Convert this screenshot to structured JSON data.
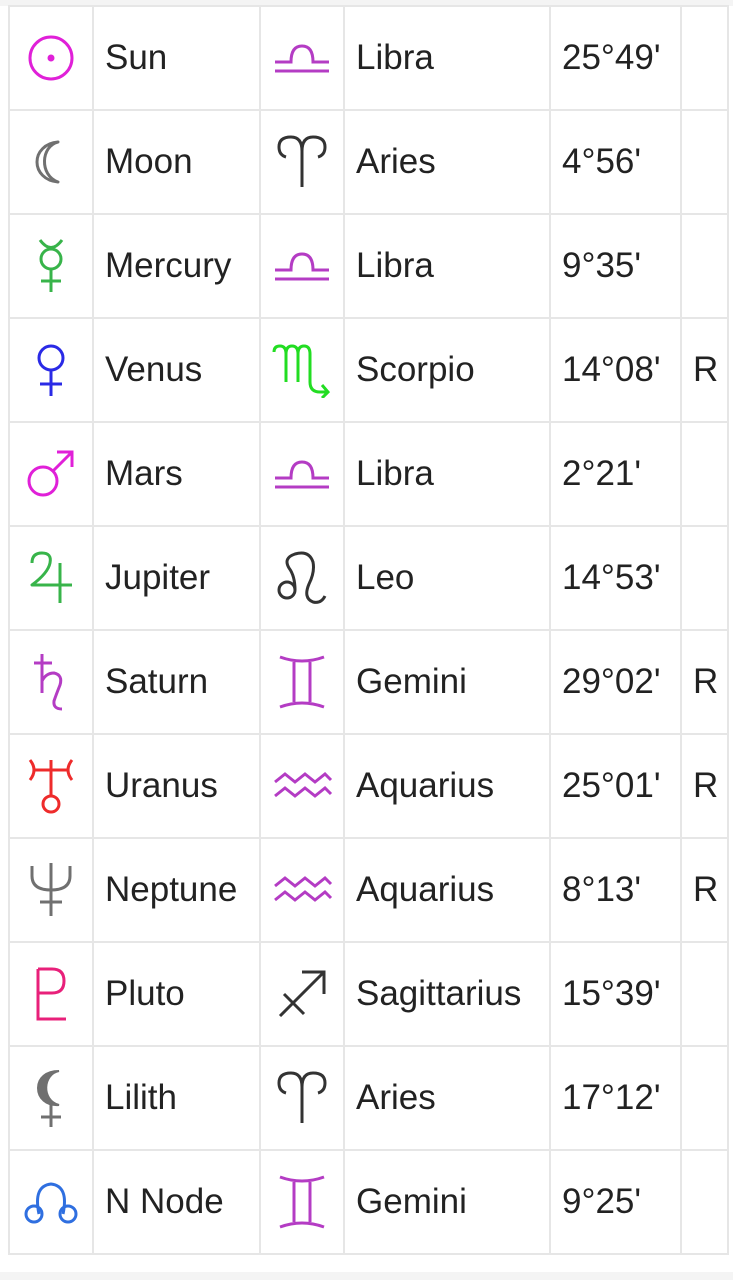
{
  "colors": {
    "magenta": "#e020d8",
    "purple": "#b43cc4",
    "gray": "#707070",
    "green": "#38b44a",
    "blue": "#2a2ae6",
    "bright_green": "#22dd22",
    "red": "#ee2b2b",
    "pink": "#e8207a",
    "dark": "#333333",
    "node_blue": "#2f6fe0",
    "text": "#222222",
    "border": "#e6e6e6"
  },
  "rows": [
    {
      "planet": "Sun",
      "planet_icon": "sun-icon",
      "planet_color": "#e020d8",
      "sign": "Libra",
      "sign_icon": "libra-icon",
      "sign_color": "#b43cc4",
      "degree": "25°49'",
      "retro": ""
    },
    {
      "planet": "Moon",
      "planet_icon": "moon-icon",
      "planet_color": "#707070",
      "sign": "Aries",
      "sign_icon": "aries-icon",
      "sign_color": "#333333",
      "degree": "4°56'",
      "retro": ""
    },
    {
      "planet": "Mercury",
      "planet_icon": "mercury-icon",
      "planet_color": "#38b44a",
      "sign": "Libra",
      "sign_icon": "libra-icon",
      "sign_color": "#b43cc4",
      "degree": "9°35'",
      "retro": ""
    },
    {
      "planet": "Venus",
      "planet_icon": "venus-icon",
      "planet_color": "#2a2ae6",
      "sign": "Scorpio",
      "sign_icon": "scorpio-icon",
      "sign_color": "#22dd22",
      "degree": "14°08'",
      "retro": "R"
    },
    {
      "planet": "Mars",
      "planet_icon": "mars-icon",
      "planet_color": "#e020d8",
      "sign": "Libra",
      "sign_icon": "libra-icon",
      "sign_color": "#b43cc4",
      "degree": "2°21'",
      "retro": ""
    },
    {
      "planet": "Jupiter",
      "planet_icon": "jupiter-icon",
      "planet_color": "#38b44a",
      "sign": "Leo",
      "sign_icon": "leo-icon",
      "sign_color": "#333333",
      "degree": "14°53'",
      "retro": ""
    },
    {
      "planet": "Saturn",
      "planet_icon": "saturn-icon",
      "planet_color": "#b43cc4",
      "sign": "Gemini",
      "sign_icon": "gemini-icon",
      "sign_color": "#b43cc4",
      "degree": "29°02'",
      "retro": "R"
    },
    {
      "planet": "Uranus",
      "planet_icon": "uranus-icon",
      "planet_color": "#ee2b2b",
      "sign": "Aquarius",
      "sign_icon": "aquarius-icon",
      "sign_color": "#b43cc4",
      "degree": "25°01'",
      "retro": "R"
    },
    {
      "planet": "Neptune",
      "planet_icon": "neptune-icon",
      "planet_color": "#707070",
      "sign": "Aquarius",
      "sign_icon": "aquarius-icon",
      "sign_color": "#b43cc4",
      "degree": "8°13'",
      "retro": "R"
    },
    {
      "planet": "Pluto",
      "planet_icon": "pluto-icon",
      "planet_color": "#e8207a",
      "sign": "Sagittarius",
      "sign_icon": "sagittarius-icon",
      "sign_color": "#333333",
      "degree": "15°39'",
      "retro": ""
    },
    {
      "planet": "Lilith",
      "planet_icon": "lilith-icon",
      "planet_color": "#707070",
      "sign": "Aries",
      "sign_icon": "aries-icon",
      "sign_color": "#333333",
      "degree": "17°12'",
      "retro": ""
    },
    {
      "planet": "N Node",
      "planet_icon": "north-node-icon",
      "planet_color": "#2f6fe0",
      "sign": "Gemini",
      "sign_icon": "gemini-icon",
      "sign_color": "#b43cc4",
      "degree": "9°25'",
      "retro": ""
    }
  ]
}
